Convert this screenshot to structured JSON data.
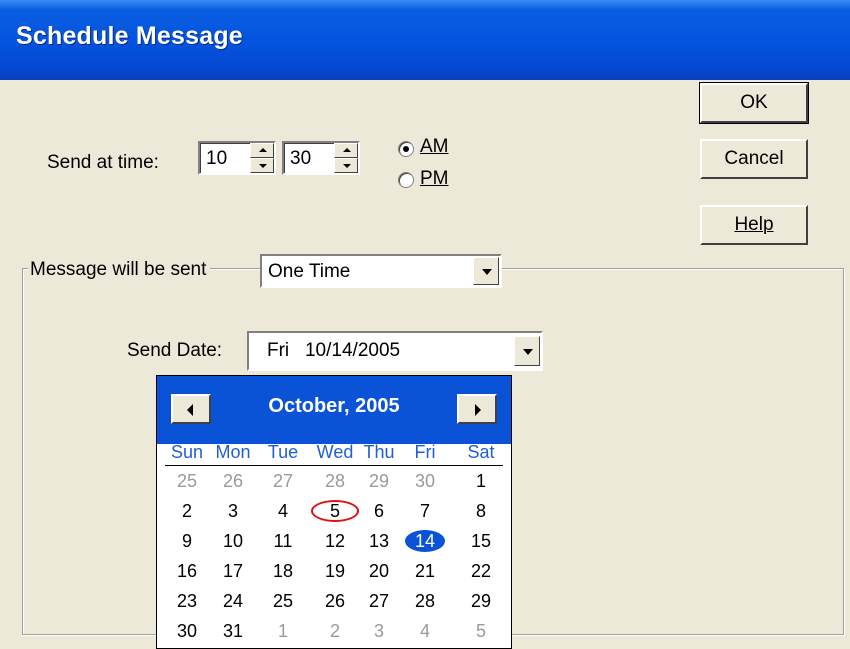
{
  "window": {
    "title": "Schedule Message"
  },
  "time": {
    "label": "Send at time:",
    "hour": "10",
    "minute": "30",
    "am_label": "AM",
    "pm_label": "PM",
    "selected": "AM"
  },
  "buttons": {
    "ok": "OK",
    "cancel": "Cancel",
    "help": "Help"
  },
  "frequency": {
    "label": "Message will be sent",
    "value": "One Time"
  },
  "send_date": {
    "label": "Send Date:",
    "value": "Fri   10/14/2005"
  },
  "calendar": {
    "month_title": "October, 2005",
    "weekdays": [
      "Sun",
      "Mon",
      "Tue",
      "Wed",
      "Thu",
      "Fri",
      "Sat"
    ],
    "weeks": [
      [
        "25",
        "26",
        "27",
        "28",
        "29",
        "30",
        "1"
      ],
      [
        "2",
        "3",
        "4",
        "5",
        "6",
        "7",
        "8"
      ],
      [
        "9",
        "10",
        "11",
        "12",
        "13",
        "14",
        "15"
      ],
      [
        "16",
        "17",
        "18",
        "19",
        "20",
        "21",
        "22"
      ],
      [
        "23",
        "24",
        "25",
        "26",
        "27",
        "28",
        "29"
      ],
      [
        "30",
        "31",
        "1",
        "2",
        "3",
        "4",
        "5"
      ]
    ],
    "selected_day": "14",
    "today_day": "5"
  },
  "colors": {
    "title_bar": "#0554e0",
    "calendar_header": "#0b53d6",
    "weekday_text": "#1e5fd8",
    "today_circle": "#e01010"
  }
}
